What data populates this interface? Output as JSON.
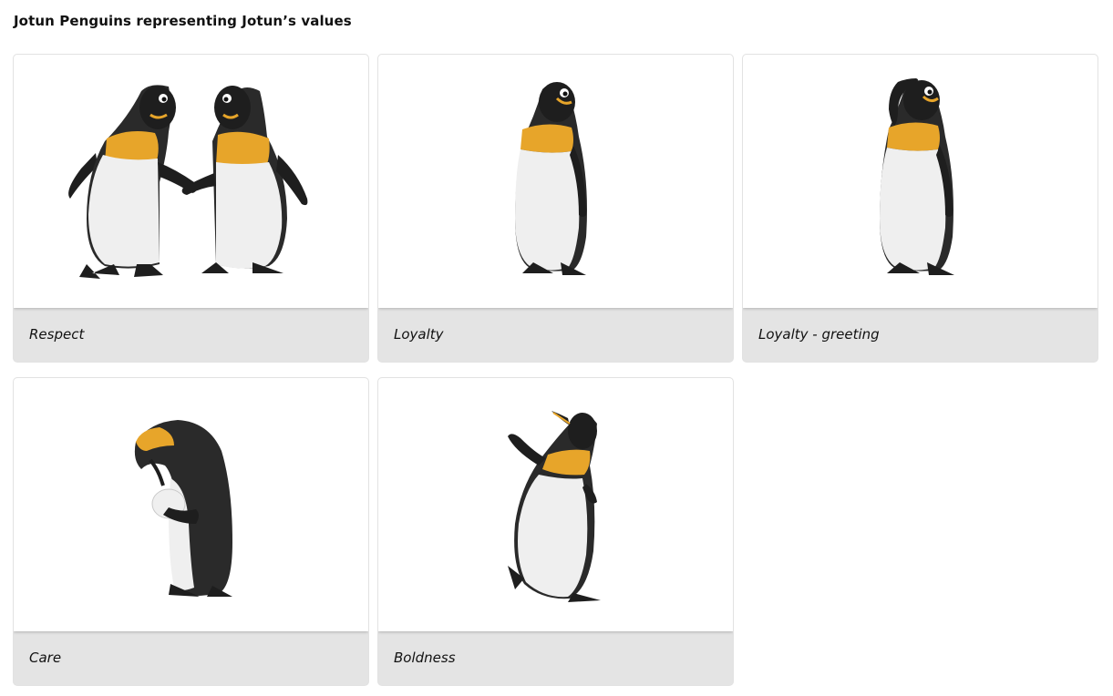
{
  "page": {
    "title": "Jotun Penguins representing Jotun’s values"
  },
  "cards": [
    {
      "caption": "Respect",
      "icon": "two-penguins-holding-hands-icon"
    },
    {
      "caption": "Loyalty",
      "icon": "penguin-standing-icon"
    },
    {
      "caption": "Loyalty - greeting",
      "icon": "penguin-saluting-icon"
    },
    {
      "caption": "Care",
      "icon": "penguin-holding-egg-icon"
    },
    {
      "caption": "Boldness",
      "icon": "penguin-walking-icon"
    }
  ],
  "colors": {
    "caption_background": "#e4e4e4",
    "image_background": "#ffffff",
    "penguin_black": "#1e1e1e",
    "penguin_white": "#efefef",
    "penguin_orange": "#e7a52a"
  }
}
